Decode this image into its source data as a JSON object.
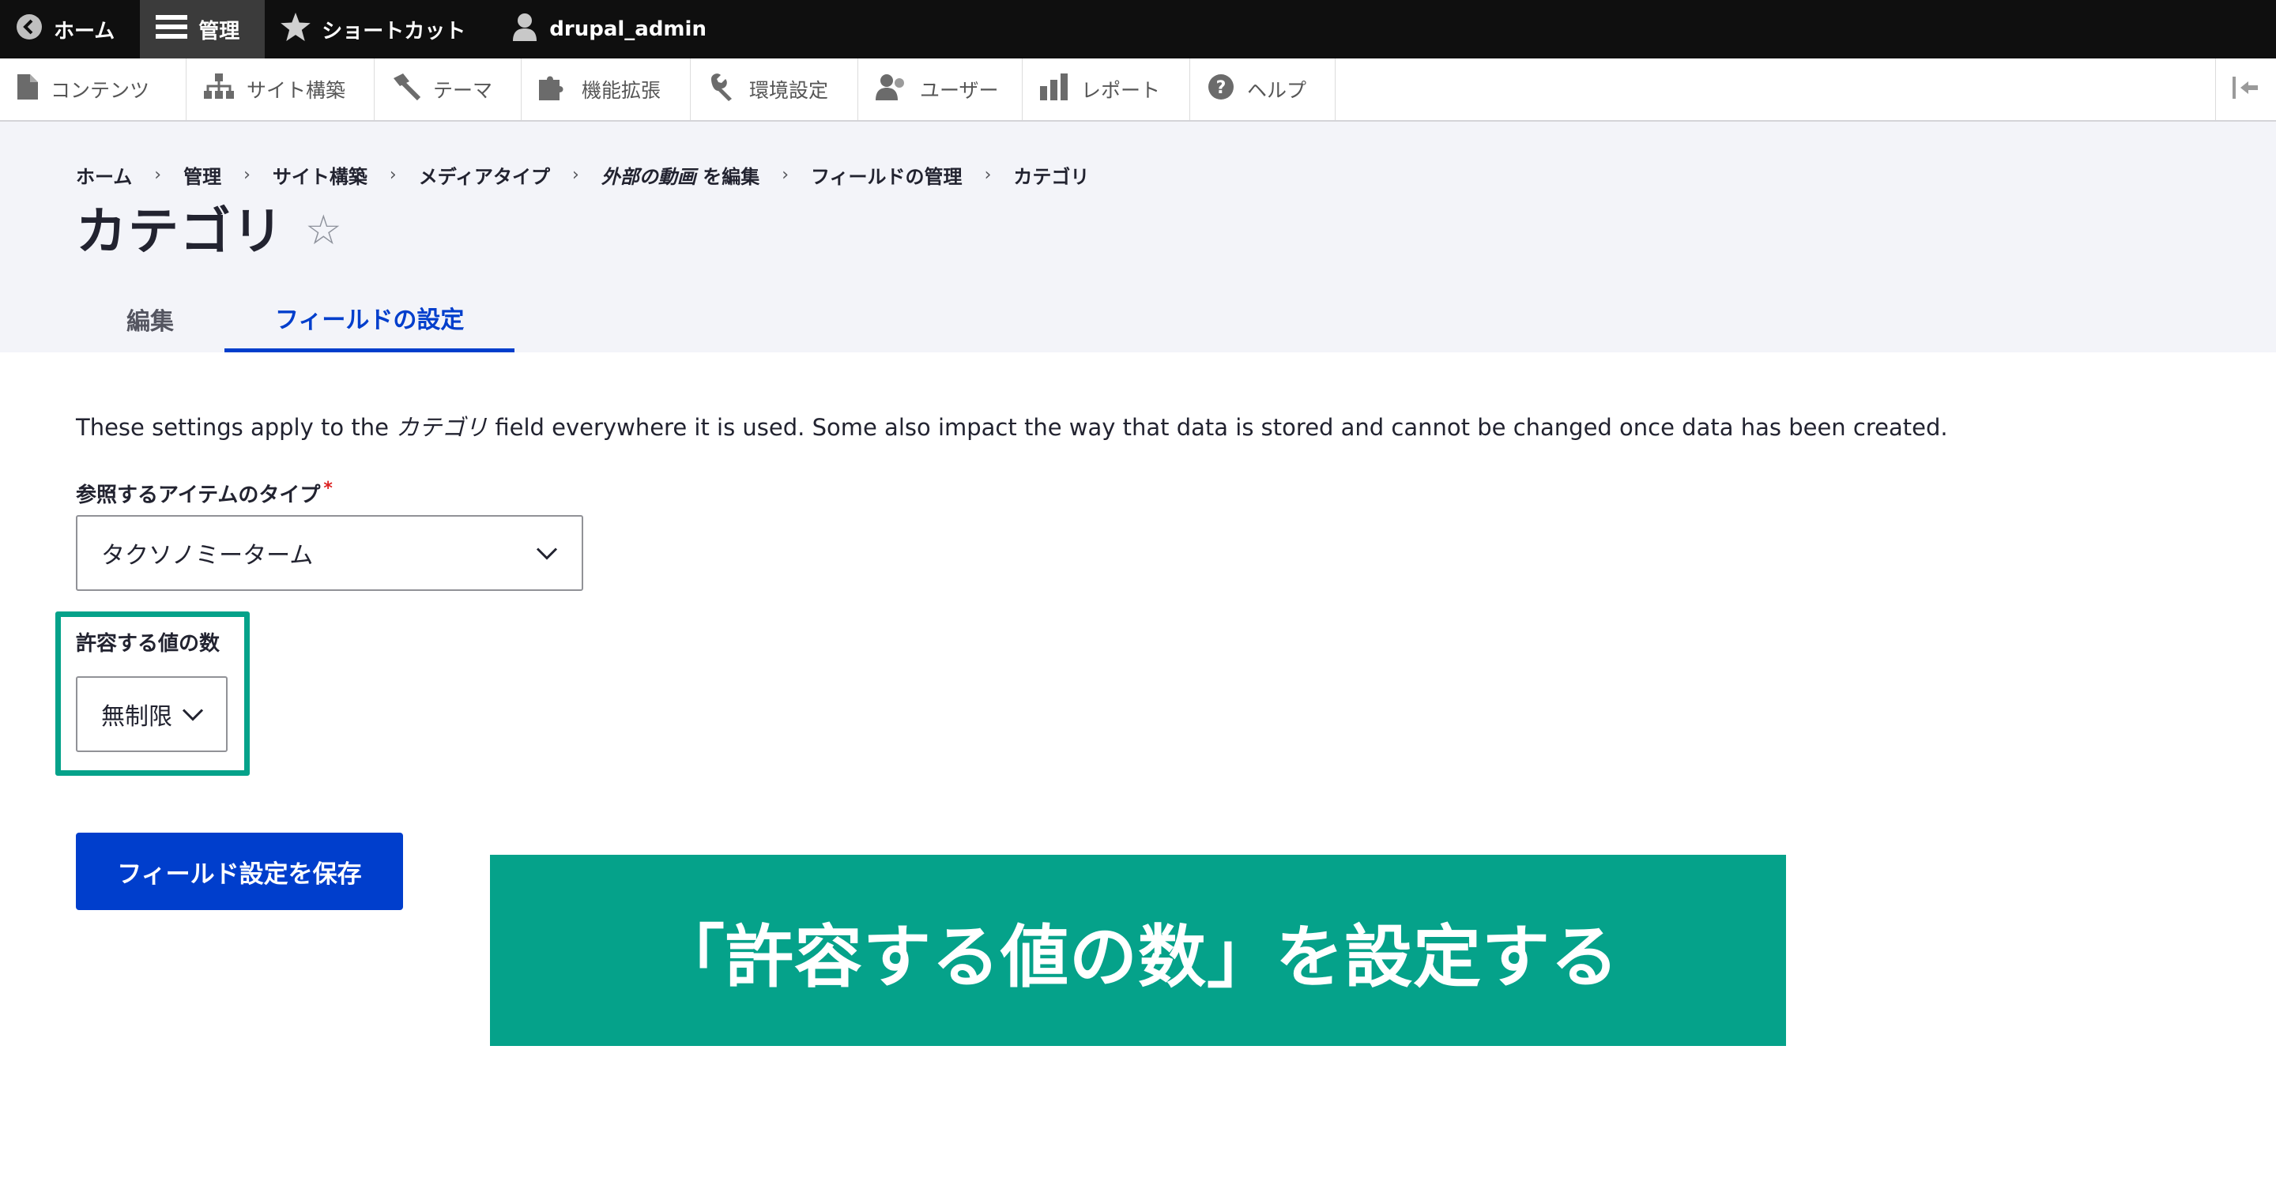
{
  "toolbar": {
    "home_label": "ホーム",
    "manage_label": "管理",
    "shortcuts_label": "ショートカット",
    "user_label": "drupal_admin"
  },
  "tray": {
    "items": [
      {
        "label": "コンテンツ",
        "icon": "file-icon"
      },
      {
        "label": "サイト構築",
        "icon": "sitemap-icon"
      },
      {
        "label": "テーマ",
        "icon": "paintbrush-icon"
      },
      {
        "label": "機能拡張",
        "icon": "puzzle-icon"
      },
      {
        "label": "環境設定",
        "icon": "wrench-icon"
      },
      {
        "label": "ユーザー",
        "icon": "people-icon"
      },
      {
        "label": "レポート",
        "icon": "bar-chart-icon"
      },
      {
        "label": "ヘルプ",
        "icon": "help-icon"
      }
    ]
  },
  "breadcrumb": [
    "ホーム",
    "管理",
    "サイト構築",
    "メディアタイプ",
    "外部の動画",
    "を編集",
    "フィールドの管理",
    "カテゴリ"
  ],
  "page": {
    "title": "カテゴリ",
    "favorite_icon": "☆"
  },
  "tabs": [
    {
      "label": "編集",
      "active": false
    },
    {
      "label": "フィールドの設定",
      "active": true
    }
  ],
  "description": {
    "before": "These settings apply to the ",
    "field_name": "カテゴリ",
    "after": " field everywhere it is used. Some also impact the way that data is stored and cannot be changed once data has been created."
  },
  "form": {
    "target_type_label": "参照するアイテムのタイプ",
    "required_mark": "*",
    "target_type_value": "タクソノミーターム",
    "cardinality_label": "許容する値の数",
    "cardinality_value": "無制限",
    "save_label": "フィールド設定を保存"
  },
  "annotation": {
    "callout_text": "「許容する値の数」を設定する",
    "accent_color": "#05a28a"
  },
  "colors": {
    "primary": "#003ecc",
    "toolbar": "#0f0f0f",
    "header_bg": "#f3f4f9"
  }
}
